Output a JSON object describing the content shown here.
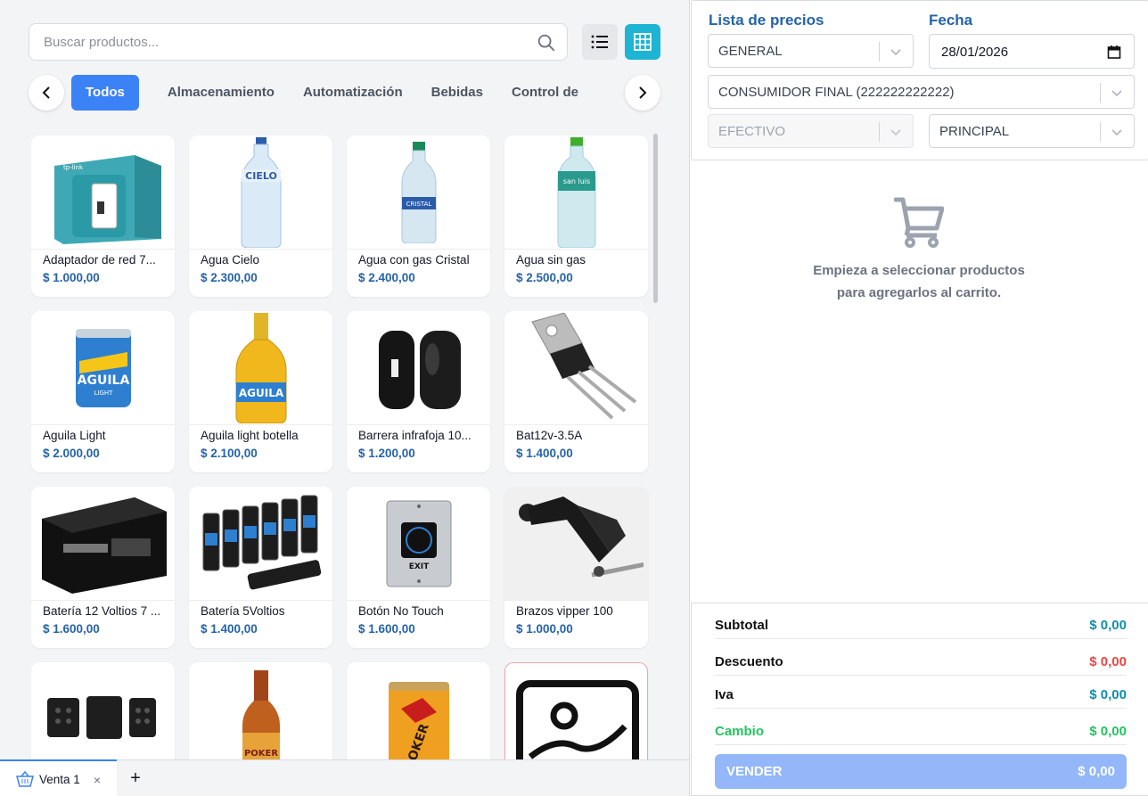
{
  "search": {
    "placeholder": "Buscar productos..."
  },
  "categories": [
    "Todos",
    "Almacenamiento",
    "Automatización",
    "Bebidas",
    "Control de"
  ],
  "products": [
    {
      "name": "Adaptador de red 7...",
      "price": "$ 1.000,00",
      "image": "tplink-box"
    },
    {
      "name": "Agua Cielo",
      "price": "$ 2.300,00",
      "image": "water-bottle"
    },
    {
      "name": "Agua con gas Cristal",
      "price": "$ 2.400,00",
      "image": "water-bottle-cristal"
    },
    {
      "name": "Agua sin gas",
      "price": "$ 2.500,00",
      "image": "water-bottle-sanluis"
    },
    {
      "name": "Aguila Light",
      "price": "$ 2.000,00",
      "image": "beer-can"
    },
    {
      "name": "Aguila light botella",
      "price": "$ 2.100,00",
      "image": "beer-bottle"
    },
    {
      "name": "Barrera infrafoja 10...",
      "price": "$ 1.200,00",
      "image": "ir-barrier"
    },
    {
      "name": "Bat12v-3.5A",
      "price": "$ 1.400,00",
      "image": "transistor"
    },
    {
      "name": "Batería 12 Voltios 7 ...",
      "price": "$ 1.600,00",
      "image": "battery-12v"
    },
    {
      "name": "Batería 5Voltios",
      "price": "$ 1.400,00",
      "image": "aa-batteries"
    },
    {
      "name": "Botón No Touch",
      "price": "$ 1.600,00",
      "image": "no-touch-button"
    },
    {
      "name": "Brazos vipper 100",
      "price": "$ 1.000,00",
      "image": "vipper-arm"
    },
    {
      "name": "",
      "price": "",
      "image": "remote-controls"
    },
    {
      "name": "",
      "price": "",
      "image": "poker-bottle"
    },
    {
      "name": "",
      "price": "",
      "image": "poker-can"
    },
    {
      "name": "",
      "price": "",
      "image": "image-placeholder"
    }
  ],
  "tabs": {
    "active_label": "Venta 1",
    "close": "×",
    "add": "+"
  },
  "form": {
    "price_list_label": "Lista de precios",
    "price_list_value": "GENERAL",
    "date_label": "Fecha",
    "date_value": "28/01/2026",
    "customer_value": "CONSUMIDOR FINAL (222222222222)",
    "payment_value": "EFECTIVO",
    "warehouse_value": "PRINCIPAL"
  },
  "cart": {
    "empty_line1": "Empieza a seleccionar productos",
    "empty_line2": "para agregarlos al carrito."
  },
  "totals": {
    "subtotal_label": "Subtotal",
    "subtotal_value": "$ 0,00",
    "discount_label": "Descuento",
    "discount_value": "$ 0,00",
    "iva_label": "Iva",
    "iva_value": "$ 0,00",
    "change_label": "Cambio",
    "change_value": "$ 0,00",
    "sell_label": "VENDER",
    "sell_value": "$ 0,00"
  },
  "colors": {
    "accent": "#3b82f6",
    "teal": "#1eb4d4",
    "label_blue": "#2563a8",
    "total_teal": "#0e8fa8",
    "discount_red": "#ef4444",
    "change_green": "#22c55e"
  }
}
